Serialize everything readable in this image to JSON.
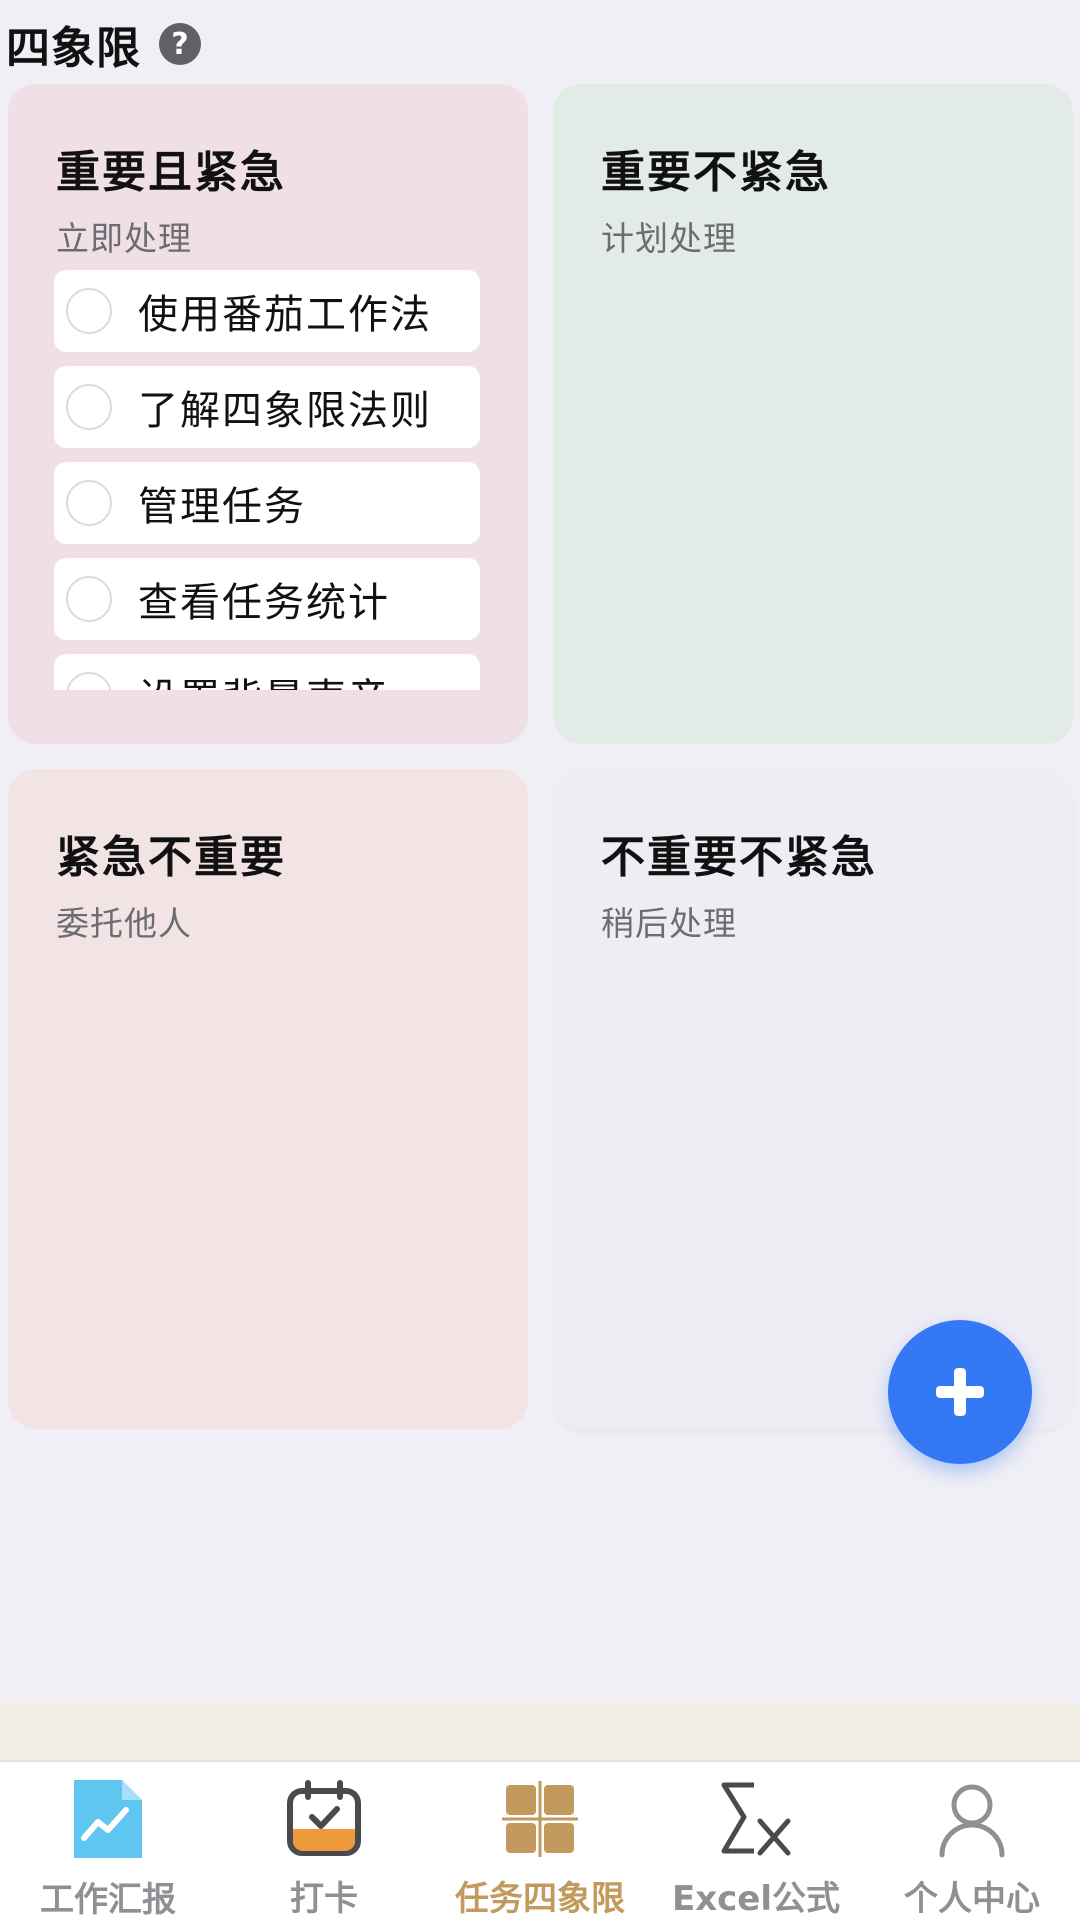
{
  "header": {
    "title": "四象限",
    "help_icon": "?"
  },
  "quadrants": [
    {
      "title": "重要且紧急",
      "subtitle": "立即处理",
      "tasks": [
        "使用番茄工作法",
        "了解四象限法则",
        "管理任务",
        "查看任务统计",
        "设置背景声音"
      ]
    },
    {
      "title": "重要不紧急",
      "subtitle": "计划处理"
    },
    {
      "title": "紧急不重要",
      "subtitle": "委托他人"
    },
    {
      "title": "不重要不紧急",
      "subtitle": "稍后处理"
    }
  ],
  "fab": {
    "icon": "plus-icon"
  },
  "tabs": [
    {
      "label": "工作汇报",
      "icon": "chart-doc-icon"
    },
    {
      "label": "打卡",
      "icon": "calendar-check-icon"
    },
    {
      "label": "任务四象限",
      "icon": "quadrant-grid-icon",
      "active": true
    },
    {
      "label": "Excel公式",
      "icon": "sigma-x-icon"
    },
    {
      "label": "个人中心",
      "icon": "user-icon"
    }
  ],
  "colors": {
    "accent": "#3478f6",
    "active_tab": "#c39a5e",
    "quadrant_1": "#f0dfe4",
    "quadrant_2": "#e3ebe6",
    "quadrant_3": "#f2e4e4",
    "quadrant_4": "#eeedf4"
  }
}
